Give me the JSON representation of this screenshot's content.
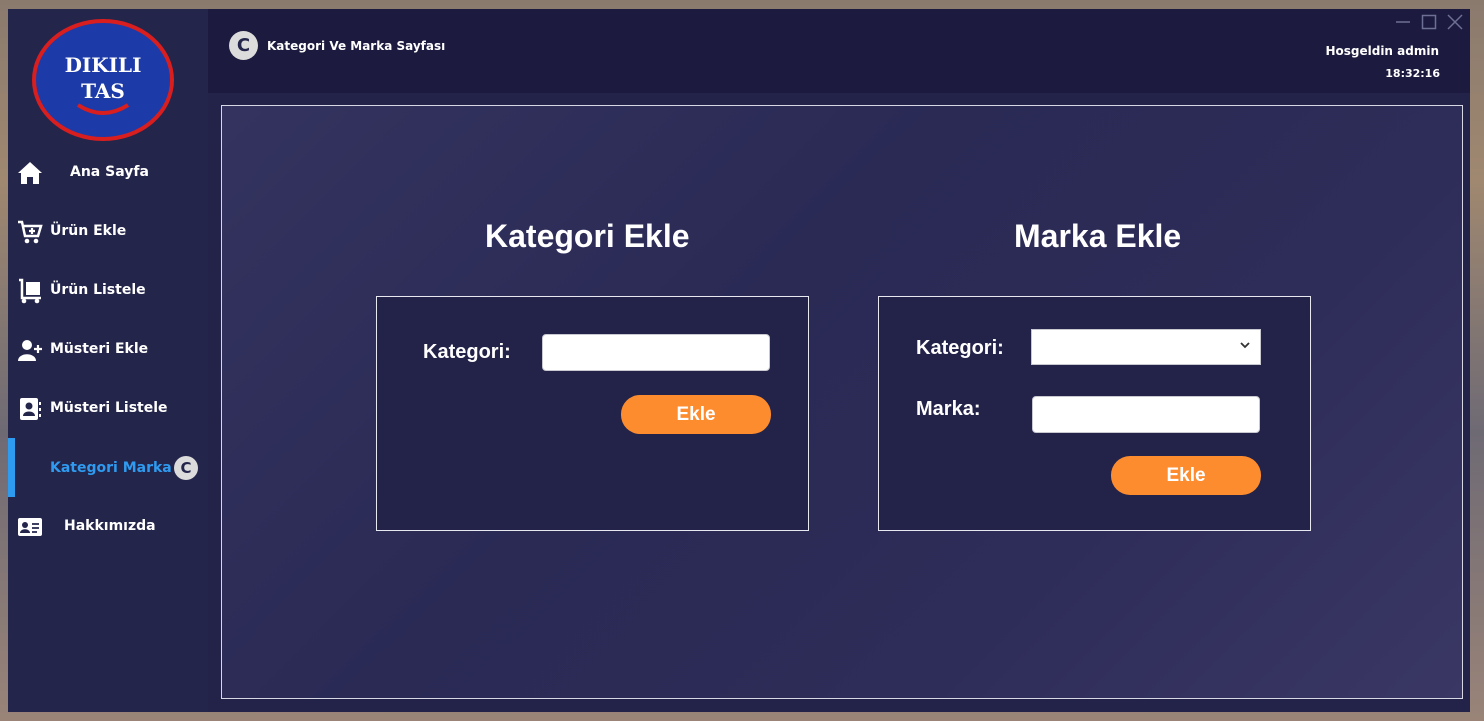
{
  "logo": {
    "line1": "DIKILI",
    "line2": "TAS",
    "border_color": "#d81e1e",
    "fill_color": "#1c3aa8"
  },
  "sidebar": {
    "items": [
      {
        "label": "Ana Sayfa",
        "icon": "home-icon"
      },
      {
        "label": "Ürün Ekle",
        "icon": "cart-plus-icon"
      },
      {
        "label": "Ürün Listele",
        "icon": "dolly-icon"
      },
      {
        "label": "Müsteri Ekle",
        "icon": "user-plus-icon"
      },
      {
        "label": "Müsteri Listele",
        "icon": "contact-book-icon"
      },
      {
        "label": "Kategori Marka",
        "icon": "c-badge-icon",
        "active": true
      },
      {
        "label": "Hakkımızda",
        "icon": "id-card-icon"
      }
    ],
    "active_color": "#2e9bf0"
  },
  "header": {
    "icon_letter": "C",
    "page_title": "Kategori Ve Marka Sayfası",
    "welcome": "Hosgeldin admin",
    "clock": "18:32:16"
  },
  "category_section": {
    "title": "Kategori Ekle",
    "field_label": "Kategori:",
    "field_value": "",
    "button_label": "Ekle"
  },
  "brand_section": {
    "title": "Marka Ekle",
    "category_label": "Kategori:",
    "category_selected": "",
    "brand_label": "Marka:",
    "brand_value": "",
    "button_label": "Ekle"
  },
  "colors": {
    "accent_button": "#fd8c2e",
    "panel_bg": "#23234a"
  }
}
